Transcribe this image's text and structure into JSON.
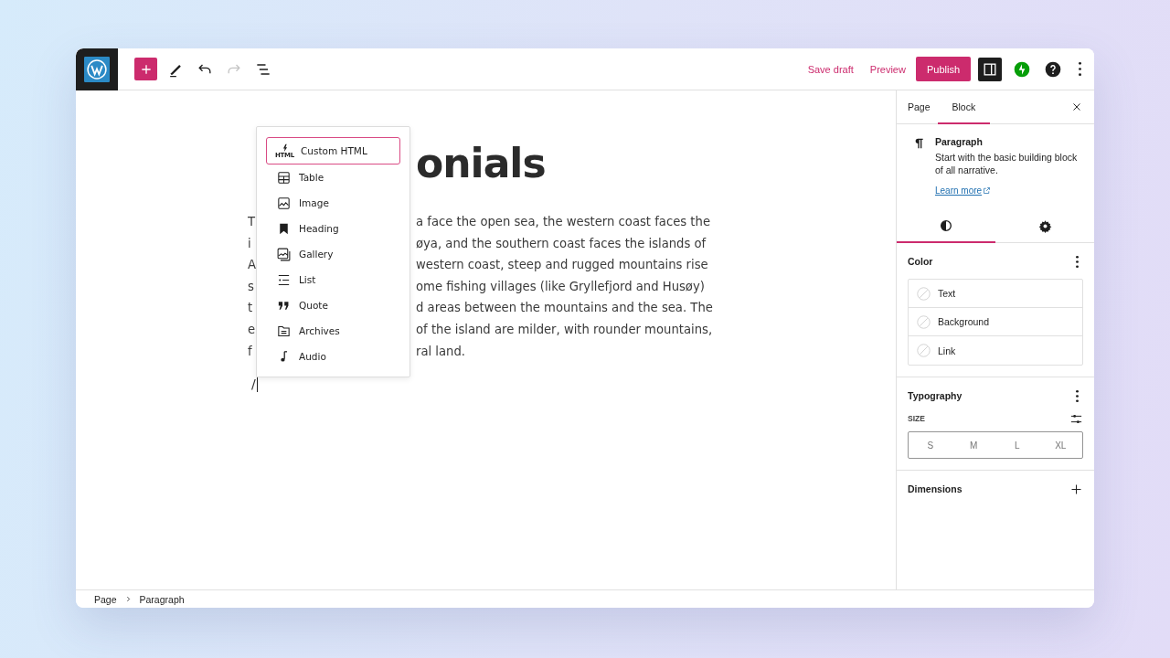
{
  "toolbar": {
    "undo": {
      "disabled": false
    },
    "redo": {
      "disabled": true
    }
  },
  "actions": [
    {
      "label": "Save draft",
      "kind": "link"
    },
    {
      "label": "Preview",
      "kind": "link"
    },
    {
      "label": "Publish",
      "kind": "primary"
    }
  ],
  "settings_toggle": {
    "on": true
  },
  "editor": {
    "title": "onials",
    "paragraph_lines": [
      {
        "left": "T",
        "right": "a face the open sea, the western coast faces the"
      },
      {
        "left": "i",
        "right": "øya, and the southern coast faces the islands of"
      },
      {
        "left": "A",
        "right": "western coast, steep and rugged mountains rise"
      },
      {
        "left": "s",
        "right": "ome fishing villages (like Gryllefjord and Husøy)"
      },
      {
        "left": "t",
        "right": "d areas between the mountains and the sea. The"
      },
      {
        "left": "e",
        "right": "of the island are milder, with rounder mountains,"
      },
      {
        "left": "f",
        "right": "ral land."
      }
    ],
    "slash": "/"
  },
  "inserter_menu": {
    "items": [
      {
        "label": "Custom HTML",
        "kind": "html",
        "icon_text": "HTML",
        "selected": true
      },
      {
        "label": "Table",
        "kind": "table",
        "selected": false
      },
      {
        "label": "Image",
        "kind": "image",
        "selected": false
      },
      {
        "label": "Heading",
        "kind": "heading",
        "selected": false
      },
      {
        "label": "Gallery",
        "kind": "gallery",
        "selected": false
      },
      {
        "label": "List",
        "kind": "list",
        "selected": false
      },
      {
        "label": "Quote",
        "kind": "quote",
        "selected": false
      },
      {
        "label": "Archives",
        "kind": "archives",
        "selected": false
      },
      {
        "label": "Audio",
        "kind": "audio",
        "selected": false
      }
    ]
  },
  "sidebar": {
    "tabs": [
      {
        "label": "Page",
        "selected": false
      },
      {
        "label": "Block",
        "selected": true
      }
    ],
    "block": {
      "name": "Paragraph",
      "description": "Start with the basic building block of all narrative.",
      "link": "Learn more"
    },
    "style_tabs": [
      {
        "kind": "styles",
        "selected": true
      },
      {
        "kind": "settings",
        "selected": false
      }
    ],
    "color": {
      "title": "Color",
      "items": [
        "Text",
        "Background",
        "Link"
      ]
    },
    "typography": {
      "title": "Typography",
      "size_label": "SIZE",
      "sizes": [
        {
          "label": "S",
          "selected": false
        },
        {
          "label": "M",
          "selected": false
        },
        {
          "label": "L",
          "selected": false
        },
        {
          "label": "XL",
          "selected": false
        }
      ]
    },
    "dimensions": {
      "title": "Dimensions"
    }
  },
  "breadcrumb": [
    "Page",
    "Paragraph"
  ]
}
